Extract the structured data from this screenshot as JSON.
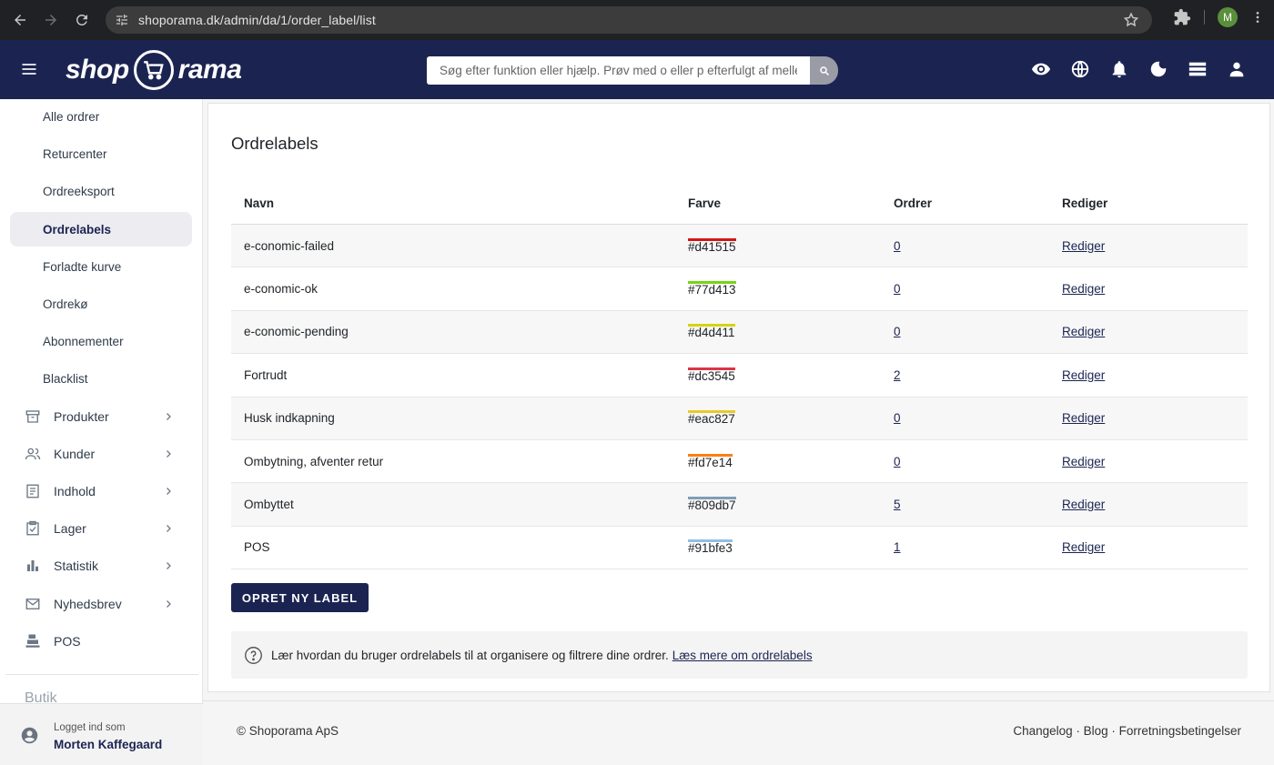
{
  "browser": {
    "url": "shoporama.dk/admin/da/1/order_label/list",
    "profile_initial": "M"
  },
  "header": {
    "logo_left": "shop",
    "logo_right": "rama",
    "search_placeholder": "Søg efter funktion eller hjælp. Prøv med o eller p efterfulgt af mellemrum"
  },
  "sidebar": {
    "sub_items": [
      {
        "label": "Alle ordrer",
        "active": false
      },
      {
        "label": "Returcenter",
        "active": false
      },
      {
        "label": "Ordreeksport",
        "active": false
      },
      {
        "label": "Ordrelabels",
        "active": true
      },
      {
        "label": "Forladte kurve",
        "active": false
      },
      {
        "label": "Ordrekø",
        "active": false
      },
      {
        "label": "Abonnementer",
        "active": false
      },
      {
        "label": "Blacklist",
        "active": false
      }
    ],
    "main_items": [
      {
        "label": "Produkter",
        "icon": "archive-icon"
      },
      {
        "label": "Kunder",
        "icon": "people-icon"
      },
      {
        "label": "Indhold",
        "icon": "document-icon"
      },
      {
        "label": "Lager",
        "icon": "clipboard-check-icon"
      },
      {
        "label": "Statistik",
        "icon": "bar-chart-icon"
      },
      {
        "label": "Nyhedsbrev",
        "icon": "mail-icon"
      },
      {
        "label": "POS",
        "icon": "cash-register-icon"
      }
    ],
    "section_label": "Butik",
    "user": {
      "label": "Logget ind som",
      "name": "Morten Kaffegaard"
    }
  },
  "main": {
    "title": "Ordrelabels",
    "columns": [
      "Navn",
      "Farve",
      "Ordrer",
      "Rediger"
    ],
    "rows": [
      {
        "name": "e-conomic-failed",
        "color": "#d41515",
        "orders": "0",
        "edit": "Rediger"
      },
      {
        "name": "e-conomic-ok",
        "color": "#77d413",
        "orders": "0",
        "edit": "Rediger"
      },
      {
        "name": "e-conomic-pending",
        "color": "#d4d411",
        "orders": "0",
        "edit": "Rediger"
      },
      {
        "name": "Fortrudt",
        "color": "#dc3545",
        "orders": "2",
        "edit": "Rediger"
      },
      {
        "name": "Husk indkapning",
        "color": "#eac827",
        "orders": "0",
        "edit": "Rediger"
      },
      {
        "name": "Ombytning, afventer retur",
        "color": "#fd7e14",
        "orders": "0",
        "edit": "Rediger"
      },
      {
        "name": "Ombyttet",
        "color": "#809db7",
        "orders": "5",
        "edit": "Rediger"
      },
      {
        "name": "POS",
        "color": "#91bfe3",
        "orders": "1",
        "edit": "Rediger"
      }
    ],
    "create_button": "OPRET NY LABEL",
    "help_text": "Lær hvordan du bruger ordrelabels til at organisere og filtrere dine ordrer.",
    "help_link": "Læs mere om ordrelabels"
  },
  "footer": {
    "copyright": "© Shoporama ApS",
    "links": "Changelog · Blog · Forretningsbetingelser"
  },
  "colors": {
    "brand_navy": "#1b2451",
    "active_bg": "#ececf1"
  }
}
